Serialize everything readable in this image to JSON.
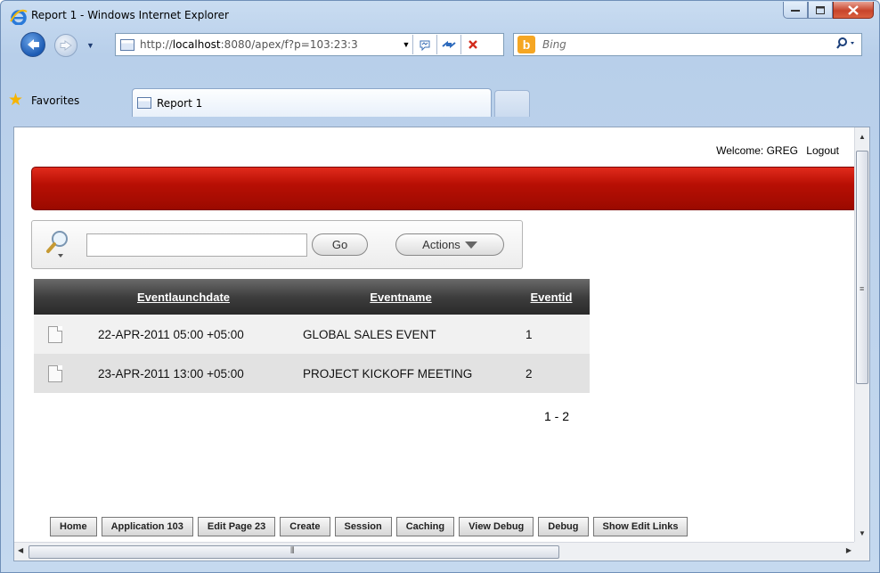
{
  "window": {
    "title": "Report 1 - Windows Internet Explorer"
  },
  "address": {
    "url_prefix": "http://",
    "url_host": "localhost",
    "url_rest": ":8080/apex/f?p=103:23:3",
    "dropdown": "▼"
  },
  "search_provider": {
    "name": "Bing",
    "logo_glyph": "b"
  },
  "favorites": {
    "label": "Favorites"
  },
  "tab": {
    "label": "Report 1"
  },
  "page": {
    "welcome_label": "Welcome: GREG",
    "logout_label": "Logout",
    "search_go_label": "Go",
    "actions_label": "Actions",
    "columns": [
      "Eventlaunchdate",
      "Eventname",
      "Eventid"
    ],
    "rows": [
      {
        "date": "22-APR-2011 05:00 +05:00",
        "name": "GLOBAL SALES EVENT",
        "id": "1"
      },
      {
        "date": "23-APR-2011 13:00 +05:00",
        "name": "PROJECT KICKOFF MEETING",
        "id": "2"
      }
    ],
    "pagination": "1 - 2",
    "dev_toolbar": [
      "Home",
      "Application 103",
      "Edit Page 23",
      "Create",
      "Session",
      "Caching",
      "View Debug",
      "Debug",
      "Show Edit Links"
    ]
  },
  "colors": {
    "banner_red": "#b80f04",
    "header_dark": "#3e3e3e",
    "window_blue": "#c5d9ef"
  },
  "icons": [
    "ie-logo-icon",
    "back-arrow-icon",
    "forward-arrow-icon",
    "page-icon",
    "compatibility-icon",
    "refresh-icon",
    "stop-icon",
    "bing-icon",
    "search-icon",
    "favorites-star-icon",
    "magnifier-icon",
    "document-icon"
  ]
}
